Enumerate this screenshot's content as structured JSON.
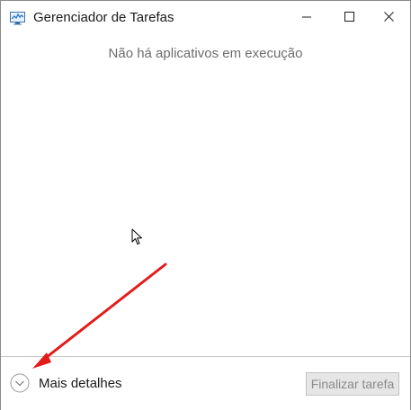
{
  "window": {
    "title": "Gerenciador de Tarefas",
    "app_icon": "task-manager-icon",
    "controls": {
      "minimize_icon": "minimize-icon",
      "maximize_icon": "maximize-icon",
      "close_icon": "close-icon"
    }
  },
  "main": {
    "empty_message": "Não há aplicativos em execução"
  },
  "footer": {
    "more_details_label": "Mais detalhes",
    "more_details_icon": "chevron-down-circle-icon",
    "end_task_label": "Finalizar tarefa",
    "end_task_enabled": false
  },
  "annotation": {
    "arrow_color": "#e31b1b"
  }
}
